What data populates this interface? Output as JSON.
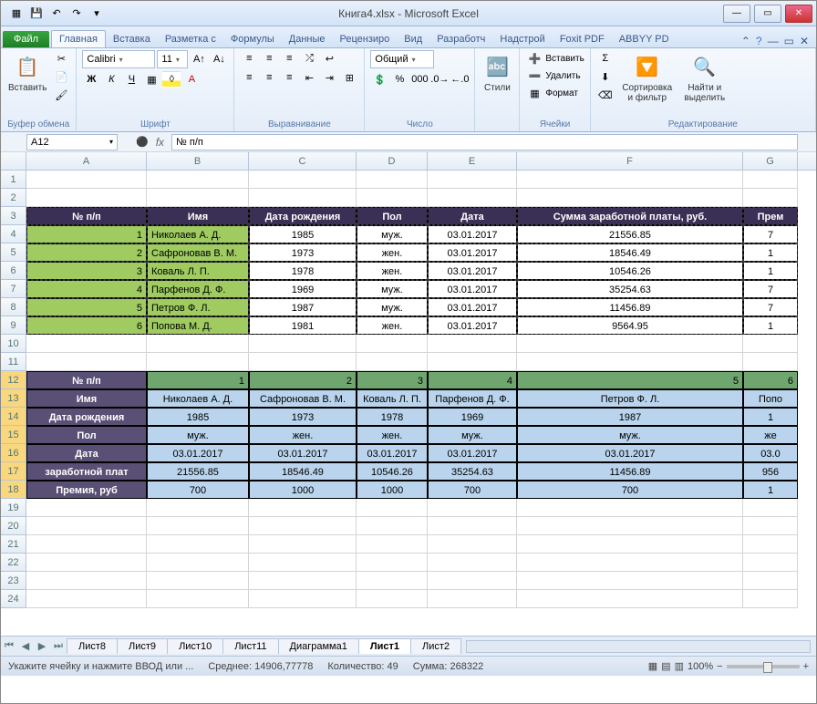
{
  "window": {
    "title": "Книга4.xlsx - Microsoft Excel"
  },
  "qat": {
    "save": "💾",
    "undo": "↶",
    "redo": "↷"
  },
  "tabs": {
    "file": "Файл",
    "list": [
      "Главная",
      "Вставка",
      "Разметка с",
      "Формулы",
      "Данные",
      "Рецензиро",
      "Вид",
      "Разработч",
      "Надстрой",
      "Foxit PDF",
      "ABBYY PD"
    ],
    "active": 0
  },
  "ribbon": {
    "clipboard": {
      "paste": "Вставить",
      "label": "Буфер обмена"
    },
    "font": {
      "name": "Calibri",
      "size": "11",
      "label": "Шрифт",
      "bold": "Ж",
      "italic": "К",
      "underline": "Ч"
    },
    "align": {
      "label": "Выравнивание"
    },
    "number": {
      "format": "Общий",
      "label": "Число"
    },
    "styles": {
      "btn": "Стили"
    },
    "cells": {
      "insert": "Вставить",
      "delete": "Удалить",
      "format": "Формат",
      "label": "Ячейки"
    },
    "editing": {
      "sort": "Сортировка и фильтр",
      "find": "Найти и выделить",
      "label": "Редактирование"
    }
  },
  "formula_bar": {
    "name_box": "A12",
    "fx": "fx",
    "formula": "№ п/п"
  },
  "columns": [
    "A",
    "B",
    "C",
    "D",
    "E",
    "F",
    "G"
  ],
  "table1": {
    "headers": [
      "№ п/п",
      "Имя",
      "Дата рождения",
      "Пол",
      "Дата",
      "Сумма заработной платы, руб.",
      "Прем"
    ],
    "rows": [
      {
        "n": "1",
        "name": "Николаев А. Д.",
        "birth": "1985",
        "sex": "муж.",
        "date": "03.01.2017",
        "sum": "21556.85",
        "prem": "7"
      },
      {
        "n": "2",
        "name": "Сафроновав В. М.",
        "birth": "1973",
        "sex": "жен.",
        "date": "03.01.2017",
        "sum": "18546.49",
        "prem": "1"
      },
      {
        "n": "3",
        "name": "Коваль Л. П.",
        "birth": "1978",
        "sex": "жен.",
        "date": "03.01.2017",
        "sum": "10546.26",
        "prem": "1"
      },
      {
        "n": "4",
        "name": "Парфенов Д. Ф.",
        "birth": "1969",
        "sex": "муж.",
        "date": "03.01.2017",
        "sum": "35254.63",
        "prem": "7"
      },
      {
        "n": "5",
        "name": "Петров Ф. Л.",
        "birth": "1987",
        "sex": "муж.",
        "date": "03.01.2017",
        "sum": "11456.89",
        "prem": "7"
      },
      {
        "n": "6",
        "name": "Попова М. Д.",
        "birth": "1981",
        "sex": "жен.",
        "date": "03.01.2017",
        "sum": "9564.95",
        "prem": "1"
      }
    ]
  },
  "table2": {
    "row_headers": [
      "№ п/п",
      "Имя",
      "Дата рождения",
      "Пол",
      "Дата",
      "заработной плат",
      "Премия, руб"
    ],
    "cols": [
      {
        "n": "1",
        "name": "Николаев А. Д.",
        "birth": "1985",
        "sex": "муж.",
        "date": "03.01.2017",
        "sum": "21556.85",
        "prem": "700"
      },
      {
        "n": "2",
        "name": "Сафроновав В. М.",
        "birth": "1973",
        "sex": "жен.",
        "date": "03.01.2017",
        "sum": "18546.49",
        "prem": "1000"
      },
      {
        "n": "3",
        "name": "Коваль Л. П.",
        "birth": "1978",
        "sex": "жен.",
        "date": "03.01.2017",
        "sum": "10546.26",
        "prem": "1000"
      },
      {
        "n": "4",
        "name": "Парфенов Д. Ф.",
        "birth": "1969",
        "sex": "муж.",
        "date": "03.01.2017",
        "sum": "35254.63",
        "prem": "700"
      },
      {
        "n": "5",
        "name": "Петров Ф. Л.",
        "birth": "1987",
        "sex": "муж.",
        "date": "03.01.2017",
        "sum": "11456.89",
        "prem": "700"
      },
      {
        "n": "6",
        "name": "Попо",
        "birth": "1",
        "sex": "же",
        "date": "03.0",
        "sum": "956",
        "prem": "1"
      }
    ]
  },
  "sheets": {
    "list": [
      "Лист8",
      "Лист9",
      "Лист10",
      "Лист11",
      "Диаграмма1",
      "Лист1",
      "Лист2"
    ],
    "active": 5
  },
  "status": {
    "hint": "Укажите ячейку и нажмите ВВОД или ...",
    "avg_label": "Среднее:",
    "avg": "14906,77778",
    "count_label": "Количество:",
    "count": "49",
    "sum_label": "Сумма:",
    "sum": "268322",
    "zoom": "100%"
  }
}
